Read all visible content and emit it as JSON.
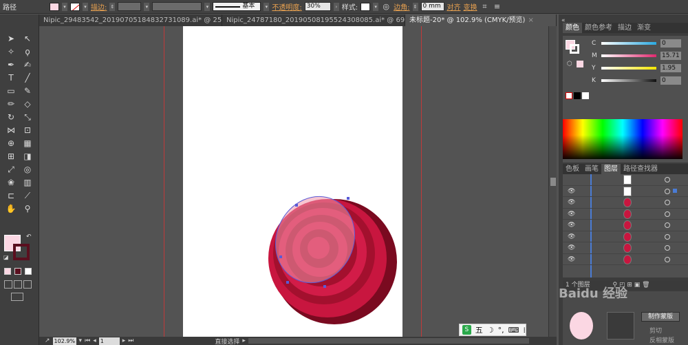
{
  "control_bar": {
    "object_label": "路径",
    "stroke_label": "描边:",
    "stroke_style": "基本",
    "opacity_label": "不透明度:",
    "opacity_value": "30%",
    "style_label": "样式:",
    "corner_label": "边角:",
    "corner_value": "0 mm",
    "align_label": "对齐",
    "transform_label": "变换",
    "fill_color": "#fbd7e3"
  },
  "tabs": [
    {
      "label": "Nipic_29483542_20190705184832731089.ai* @ 25...",
      "close": "×"
    },
    {
      "label": "Nipic_24787180_20190508195524308085.ai* @ 69...",
      "close": "×"
    },
    {
      "label": "未标题-20* @ 102.9% (CMYK/预览)",
      "close": "×"
    }
  ],
  "status_bar": {
    "zoom": "102.9%",
    "page": "1",
    "tool_name": "直接选择"
  },
  "color_panel": {
    "tabs": [
      "颜色",
      "颜色参考",
      "描边",
      "渐变"
    ],
    "sliders": [
      {
        "letter": "C",
        "value": "0"
      },
      {
        "letter": "M",
        "value": "15.71"
      },
      {
        "letter": "Y",
        "value": "1.95"
      },
      {
        "letter": "K",
        "value": "0"
      }
    ],
    "slider_colors": [
      "#2aa8e0",
      "#e0286e",
      "#f3e500",
      "#111111"
    ]
  },
  "layers_panel": {
    "tabs": [
      "色板",
      "画笔",
      "图层",
      "路径查找器"
    ],
    "footer": "1 个图层",
    "row_count": 8
  },
  "bottom_panel": {
    "make_mask": "制作蒙版",
    "clip": "剪切",
    "invert_mask": "反相蒙版"
  },
  "ime": {
    "logo": "S",
    "mode": "五"
  },
  "watermark": "Baidu 经验",
  "colors": {
    "ball_dark": "#a3102e",
    "ball_mid": "#c8163f",
    "ring_light": "#e0506e",
    "ring_dark": "#c83a5a",
    "selection": "#5b5bd6"
  }
}
